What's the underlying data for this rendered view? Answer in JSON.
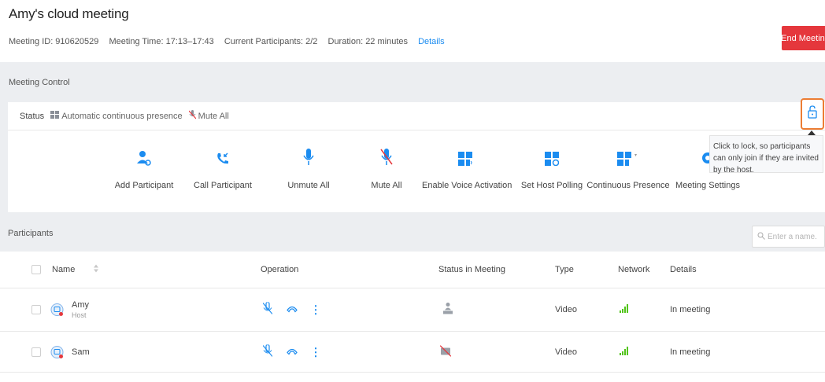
{
  "meeting": {
    "title": "Amy's cloud meeting",
    "meeting_id": "Meeting ID: 910620529",
    "meeting_time": "Meeting Time: 17:13–17:43",
    "participants": "Current Participants: 2/2",
    "duration": "Duration: 22 minutes",
    "details_link": "Details",
    "end_button": "End Meeting"
  },
  "control": {
    "section_title": "Meeting Control",
    "status_label": "Status",
    "status_presence": "Automatic continuous presence",
    "status_mute": "Mute All",
    "lock_tooltip": "Click to lock, so participants can only join if they are invited by the host.",
    "buttons": [
      {
        "label": "Add Participant",
        "icon": "add-participant-icon"
      },
      {
        "label": "Call Participant",
        "icon": "call-participant-icon"
      },
      {
        "label": "Unmute All",
        "icon": "microphone-icon"
      },
      {
        "label": "Mute All",
        "icon": "microphone-muted-icon"
      },
      {
        "label": "Enable Voice Activation",
        "icon": "voice-activation-icon"
      },
      {
        "label": "Set Host Polling",
        "icon": "host-polling-icon"
      },
      {
        "label": "Continuous Presence",
        "icon": "continuous-presence-icon"
      },
      {
        "label": "Meeting Settings",
        "icon": "settings-icon"
      }
    ]
  },
  "participants": {
    "section_title": "Participants",
    "search_placeholder": "Enter a name.",
    "columns": {
      "name": "Name",
      "operation": "Operation",
      "status": "Status in Meeting",
      "type": "Type",
      "network": "Network",
      "details": "Details"
    },
    "rows": [
      {
        "name": "Amy",
        "role": "Host",
        "type": "Video",
        "details": "In meeting"
      },
      {
        "name": "Sam",
        "role": "",
        "type": "Video",
        "details": "In meeting"
      }
    ]
  },
  "colors": {
    "accent": "#1b8cf0",
    "danger": "#e5373c",
    "highlight": "#ec7d33",
    "network": "#52c41a",
    "band": "#eceef1"
  }
}
